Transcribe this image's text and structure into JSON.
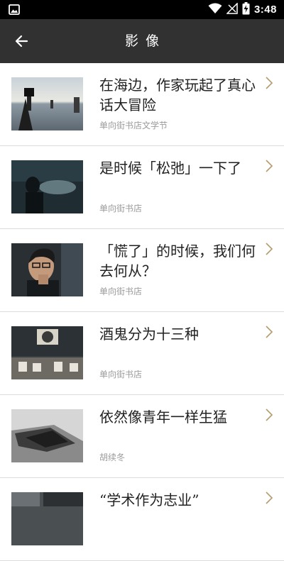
{
  "status_bar": {
    "time": "3:48"
  },
  "app_bar": {
    "title": "影像"
  },
  "colors": {
    "app_bar": "#313131",
    "chevron": "#b59a6a",
    "source_text": "#9a9a9a"
  },
  "items": [
    {
      "title": "在海边，作家玩起了真心话大冒险",
      "source": "单向街书店文学节"
    },
    {
      "title": "是时候「松弛」一下了",
      "source": "单向街书店"
    },
    {
      "title": "「慌了」的时候，我们何去何从？",
      "source": "单向街书店"
    },
    {
      "title": "酒鬼分为十三种",
      "source": "单向街书店"
    },
    {
      "title": "依然像青年一样生猛",
      "source": "胡续冬"
    },
    {
      "title": "“学术作为志业”",
      "source": ""
    }
  ]
}
